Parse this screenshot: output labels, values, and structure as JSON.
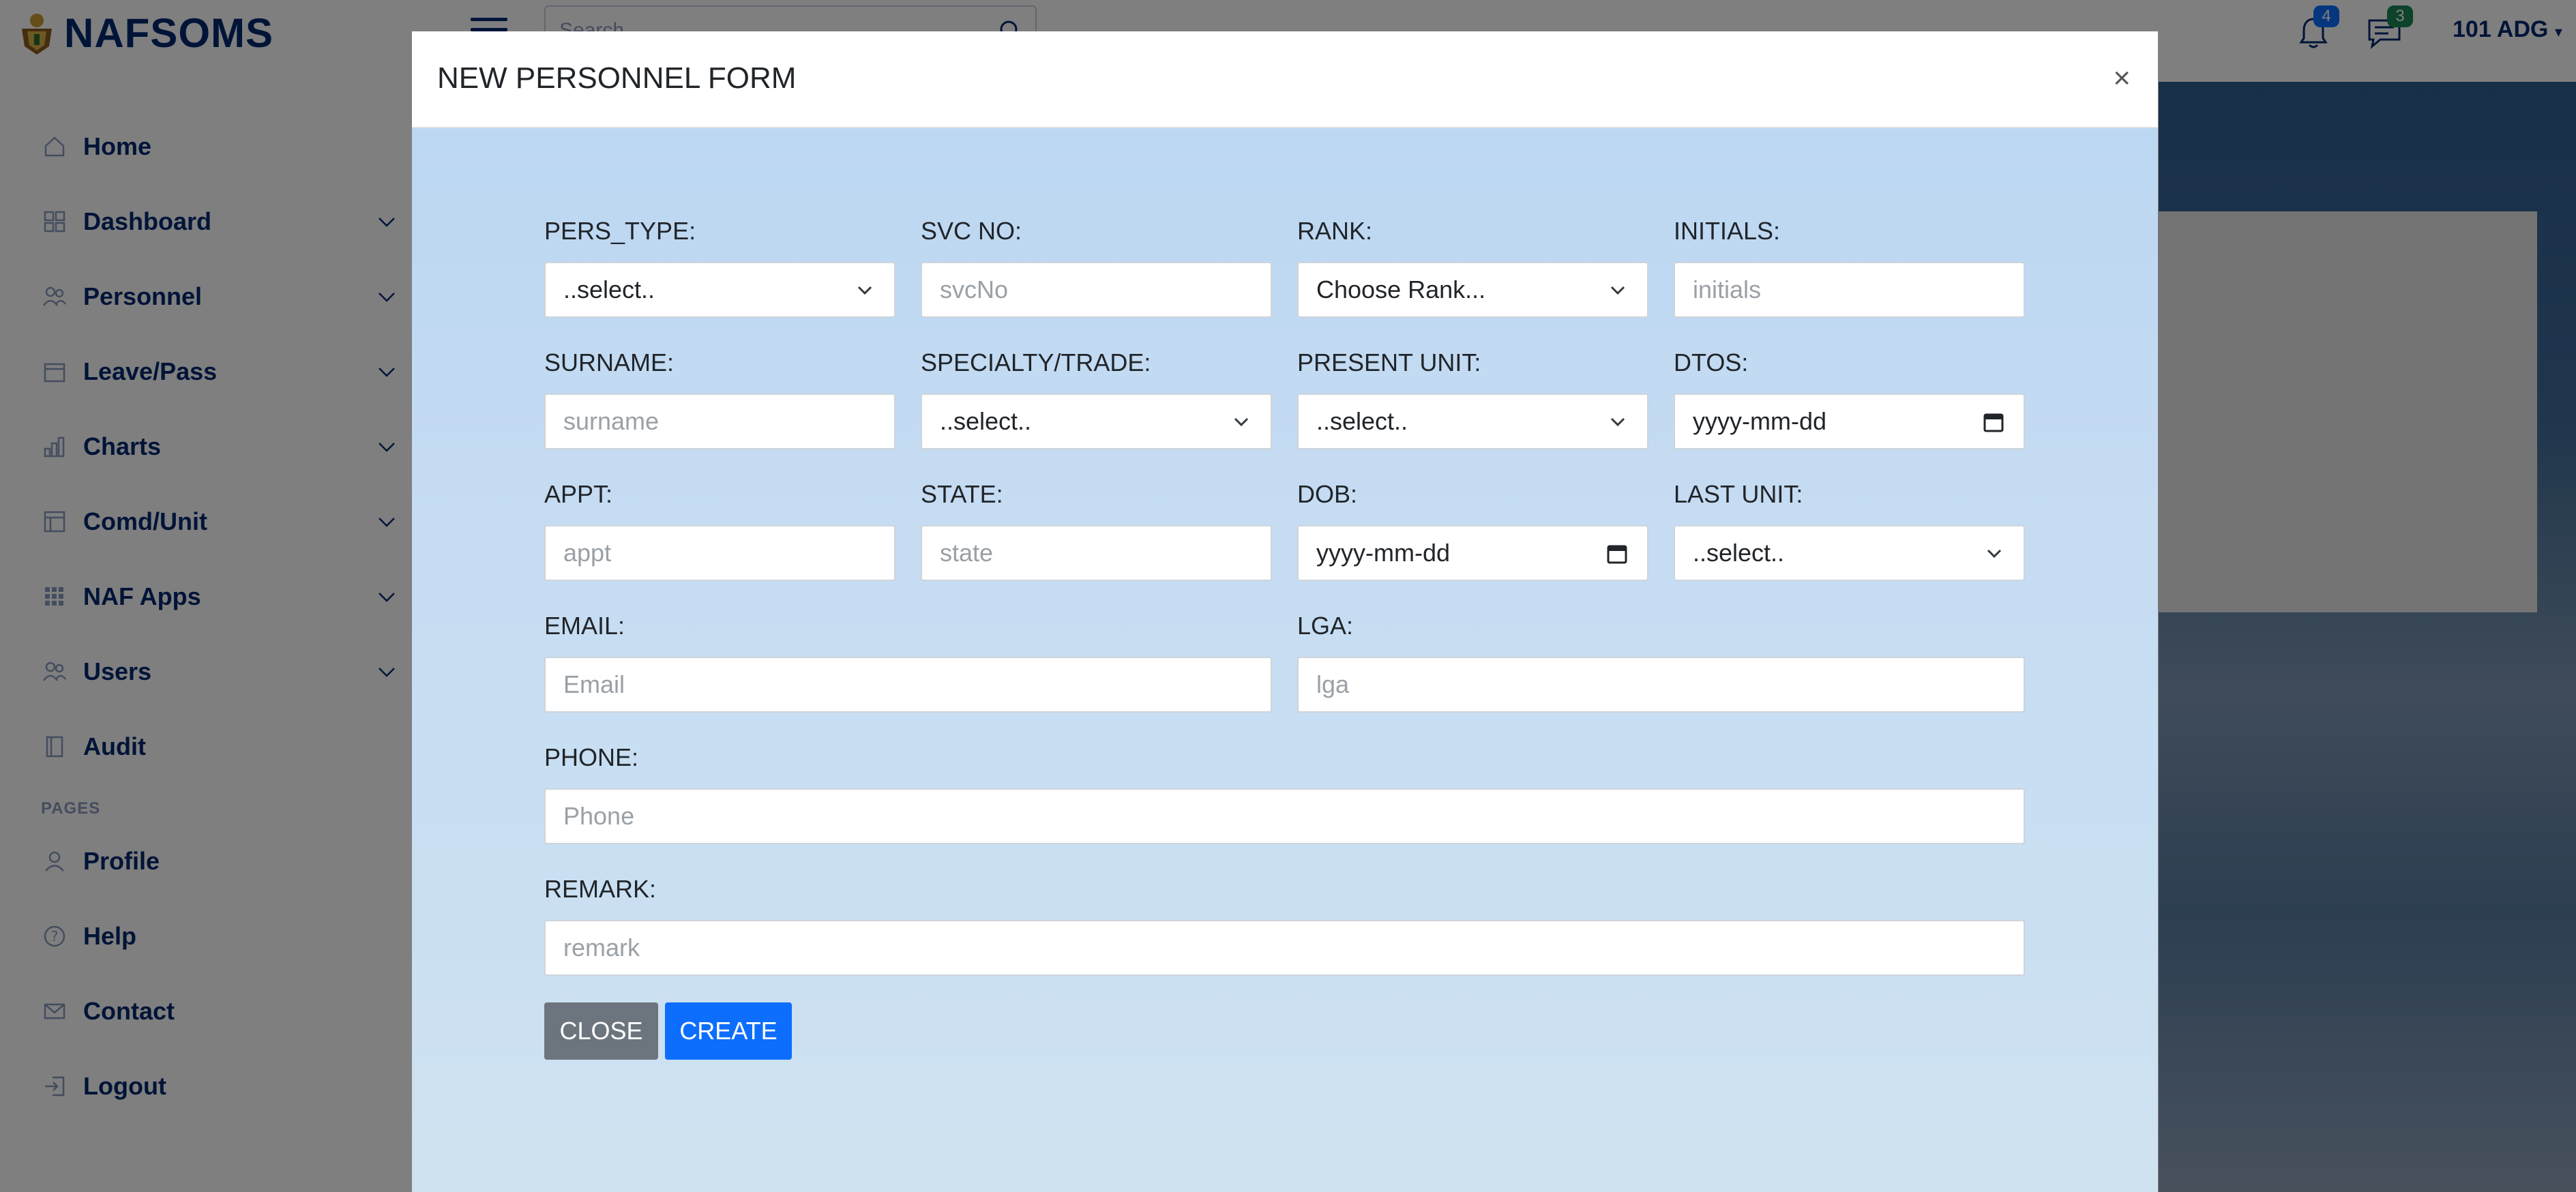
{
  "header": {
    "brand": "NAFSOMS",
    "search_placeholder": "Search",
    "notifications_count": "4",
    "messages_count": "3",
    "user": "101 ADG",
    "colors": {
      "notif_badge": "#0d6efd",
      "msg_badge": "#198754"
    }
  },
  "sidebar": {
    "items": [
      {
        "label": "Home",
        "icon": "house-icon"
      },
      {
        "label": "Dashboard",
        "icon": "grid-icon"
      },
      {
        "label": "Personnel",
        "icon": "people-icon"
      },
      {
        "label": "Leave/Pass",
        "icon": "calendar-icon"
      },
      {
        "label": "Charts",
        "icon": "bar-chart-icon"
      },
      {
        "label": "Comd/Unit",
        "icon": "layout-icon"
      },
      {
        "label": "NAF Apps",
        "icon": "apps-grid-icon"
      },
      {
        "label": "Users",
        "icon": "people-icon"
      },
      {
        "label": "Audit",
        "icon": "journal-icon"
      }
    ],
    "pages_heading": "PAGES",
    "pages": [
      {
        "label": "Profile",
        "icon": "person-icon"
      },
      {
        "label": "Help",
        "icon": "question-circle-icon"
      },
      {
        "label": "Contact",
        "icon": "envelope-icon"
      },
      {
        "label": "Logout",
        "icon": "box-arrow-in-right-icon"
      }
    ]
  },
  "modal": {
    "title": "NEW PERSONNEL FORM",
    "close_symbol": "×",
    "fields": {
      "pers_type": {
        "label": "PERS_TYPE:",
        "value": "..select.."
      },
      "svc_no": {
        "label": "SVC NO:",
        "placeholder": "svcNo"
      },
      "rank": {
        "label": "RANK:",
        "value": "Choose Rank..."
      },
      "initials": {
        "label": "INITIALS:",
        "placeholder": "initials"
      },
      "surname": {
        "label": "SURNAME:",
        "placeholder": "surname"
      },
      "specialty": {
        "label": "SPECIALTY/TRADE:",
        "value": "..select.."
      },
      "present_unit": {
        "label": "PRESENT UNIT:",
        "value": "..select.."
      },
      "dtos": {
        "label": "DTOS:",
        "value": "yyyy-mm-dd"
      },
      "appt": {
        "label": "APPT:",
        "placeholder": "appt"
      },
      "state": {
        "label": "STATE:",
        "placeholder": "state"
      },
      "dob": {
        "label": "DOB:",
        "value": "yyyy-mm-dd"
      },
      "last_unit": {
        "label": "LAST UNIT:",
        "value": "..select.."
      },
      "email": {
        "label": "EMAIL:",
        "placeholder": "Email"
      },
      "lga": {
        "label": "LGA:",
        "placeholder": "lga"
      },
      "phone": {
        "label": "PHONE:",
        "placeholder": "Phone"
      },
      "remark": {
        "label": "REMARK:",
        "placeholder": "remark"
      }
    },
    "buttons": {
      "close": "CLOSE",
      "create": "CREATE",
      "colors": {
        "close": "#6c757d",
        "create": "#0d6efd"
      }
    }
  }
}
